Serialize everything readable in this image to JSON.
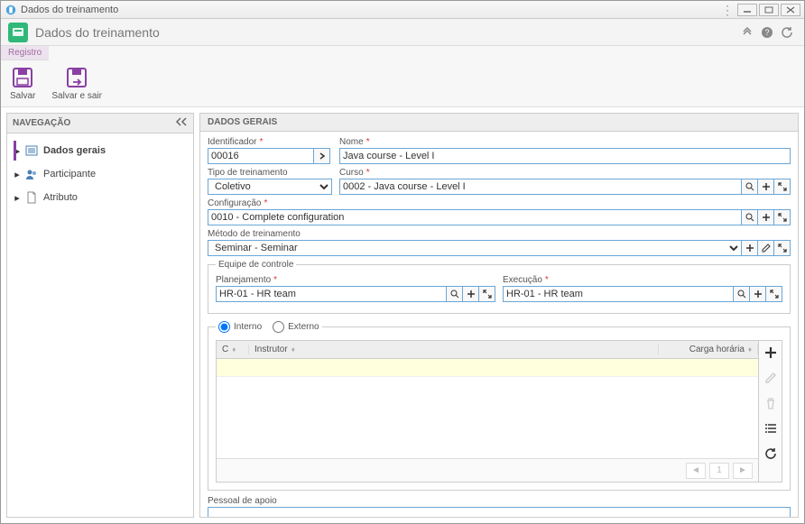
{
  "window": {
    "title": "Dados do treinamento"
  },
  "header": {
    "title": "Dados do treinamento"
  },
  "ribbon": {
    "tab": "Registro",
    "save": "Salvar",
    "save_exit": "Salvar e sair"
  },
  "nav": {
    "title": "NAVEGAÇÃO",
    "items": [
      {
        "label": "Dados gerais"
      },
      {
        "label": "Participante"
      },
      {
        "label": "Atributo"
      }
    ]
  },
  "form": {
    "section_title": "DADOS GERAIS",
    "identificador": {
      "label": "Identificador",
      "value": "00016"
    },
    "nome": {
      "label": "Nome",
      "value": "Java course - Level I"
    },
    "tipo": {
      "label": "Tipo de treinamento",
      "value": "Coletivo"
    },
    "curso": {
      "label": "Curso",
      "value": "0002 - Java course - Level I"
    },
    "config": {
      "label": "Configuração",
      "value": "0010 - Complete configuration"
    },
    "metodo": {
      "label": "Método de treinamento",
      "value": "Seminar - Seminar"
    },
    "equipe": {
      "legend": "Equipe de controle",
      "plan": {
        "label": "Planejamento",
        "value": "HR-01 - HR team"
      },
      "exec": {
        "label": "Execução",
        "value": "HR-01 - HR team"
      }
    },
    "radios": {
      "interno": "Interno",
      "externo": "Externo"
    },
    "table": {
      "cols": {
        "c": "C",
        "instrutor": "Instrutor",
        "carga": "Carga horária"
      },
      "page": "1"
    },
    "apoio": {
      "label": "Pessoal de apoio",
      "value": ""
    }
  }
}
